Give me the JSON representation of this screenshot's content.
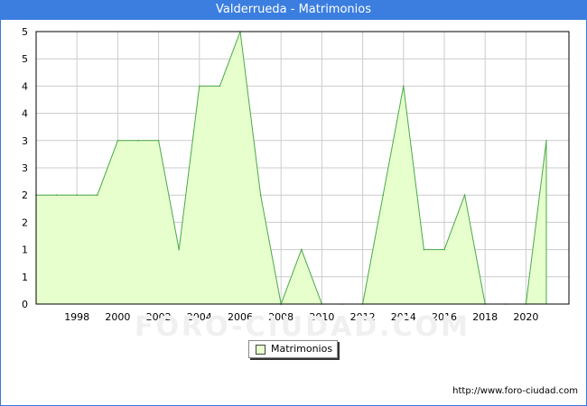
{
  "header": {
    "title": "Valderrueda - Matrimonios"
  },
  "chart_data": {
    "type": "area",
    "title": "Valderrueda - Matrimonios",
    "xlabel": "",
    "ylabel": "",
    "x": [
      1996,
      1997,
      1998,
      1999,
      2000,
      2001,
      2002,
      2003,
      2004,
      2005,
      2006,
      2007,
      2008,
      2009,
      2010,
      2011,
      2012,
      2013,
      2014,
      2015,
      2016,
      2017,
      2018,
      2019,
      2020,
      2021
    ],
    "series": [
      {
        "name": "Matrimonios",
        "values": [
          2,
          2,
          2,
          2,
          3,
          3,
          3,
          1,
          4,
          4,
          5,
          2,
          0,
          1,
          0,
          0,
          0,
          2,
          4,
          1,
          1,
          2,
          0,
          0,
          0,
          3
        ]
      }
    ],
    "x_tick_labels": [
      "1998",
      "2000",
      "2002",
      "2004",
      "2006",
      "2008",
      "2010",
      "2012",
      "2014",
      "2016",
      "2018",
      "2020"
    ],
    "y_tick_labels": [
      "0",
      "1",
      "1",
      "2",
      "2",
      "3",
      "3",
      "4",
      "4",
      "5",
      "5"
    ],
    "ylim": [
      0,
      5
    ],
    "grid": true,
    "legend_position": "bottom-center",
    "colors": {
      "fill": "#e6ffcc",
      "line": "#4aa84a",
      "titlebar": "#3b7ee0",
      "grid": "#cccccc"
    }
  },
  "legend": {
    "label": "Matrimonios"
  },
  "watermark": "FORO-CIUDAD.COM",
  "source": {
    "url": "http://www.foro-ciudad.com"
  }
}
